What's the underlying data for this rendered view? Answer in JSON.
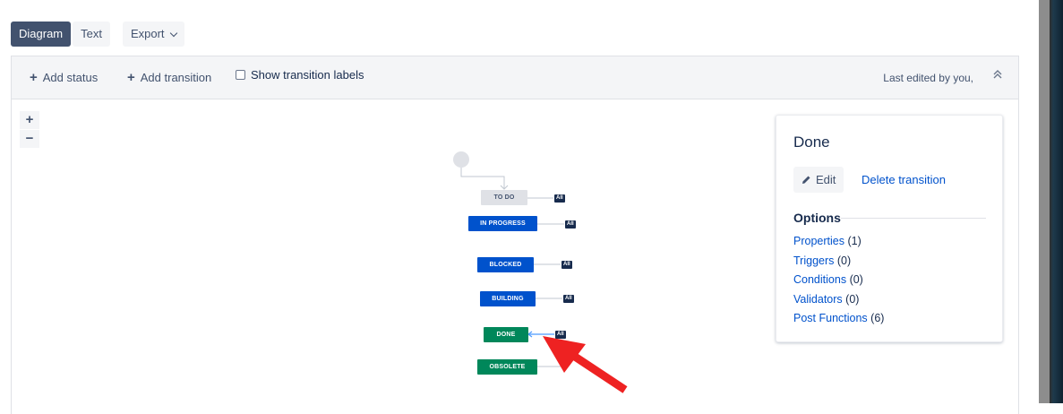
{
  "tabs": {
    "diagram": "Diagram",
    "text": "Text",
    "export": "Export"
  },
  "toolbar": {
    "add_status": "Add status",
    "add_transition": "Add transition",
    "show_labels": "Show transition labels",
    "last_edited": "Last edited by you,"
  },
  "zoom": {
    "in": "+",
    "out": "−"
  },
  "diagram": {
    "statuses": [
      {
        "label": "TO DO",
        "category": "todo"
      },
      {
        "label": "IN PROGRESS",
        "category": "in-progress"
      },
      {
        "label": "BLOCKED",
        "category": "in-progress"
      },
      {
        "label": "BUILDING",
        "category": "in-progress"
      },
      {
        "label": "DONE",
        "category": "done"
      },
      {
        "label": "OBSOLETE",
        "category": "done"
      }
    ],
    "all_label": "All",
    "colors": {
      "todo": "#dfe1e6",
      "in_progress": "#0052cc",
      "done": "#00875a",
      "annotation_arrow": "#ee2222"
    }
  },
  "panel": {
    "title": "Done",
    "edit_label": "Edit",
    "delete_label": "Delete transition",
    "options_heading": "Options",
    "options": [
      {
        "label": "Properties",
        "count": "(1)"
      },
      {
        "label": "Triggers",
        "count": "(0)"
      },
      {
        "label": "Conditions",
        "count": "(0)"
      },
      {
        "label": "Validators",
        "count": "(0)"
      },
      {
        "label": "Post Functions",
        "count": "(6)"
      }
    ]
  }
}
